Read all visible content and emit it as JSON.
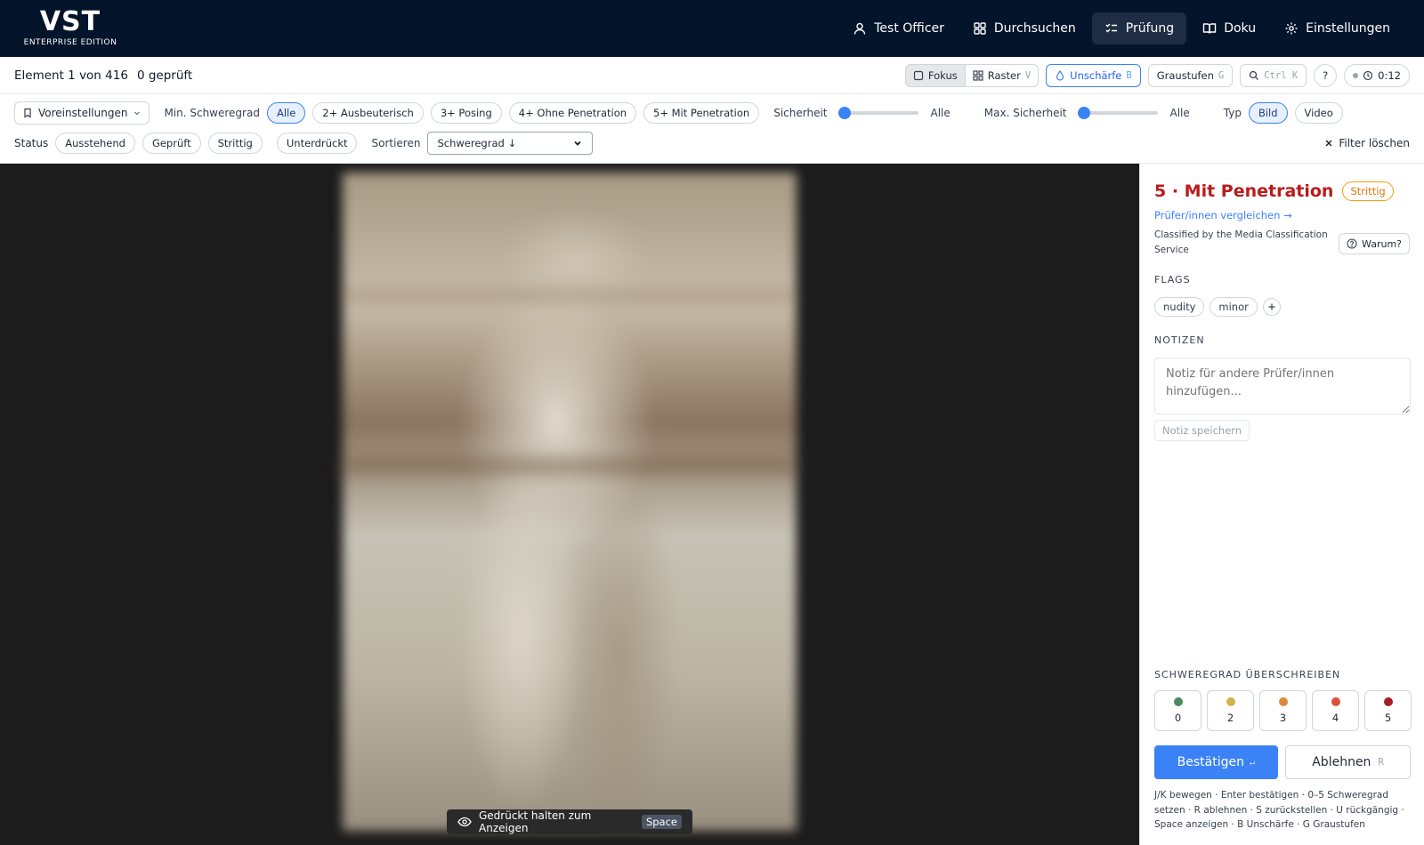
{
  "brand": {
    "name": "VST",
    "edition": "ENTERPRISE EDITION"
  },
  "nav": [
    {
      "label": "Test Officer",
      "icon": "user-icon"
    },
    {
      "label": "Durchsuchen",
      "icon": "grid-icon"
    },
    {
      "label": "Prüfung",
      "icon": "checklist-icon",
      "active": true
    },
    {
      "label": "Doku",
      "icon": "book-icon"
    },
    {
      "label": "Einstellungen",
      "icon": "gear-icon"
    }
  ],
  "status": {
    "position": "Element 1 von 416",
    "reviewed": "0 geprüft"
  },
  "toolbar": {
    "focus_label": "Fokus",
    "grid_label": "Raster",
    "grid_key": "V",
    "blur_label": "Unschärfe",
    "blur_key": "B",
    "grayscale_label": "Graustufen",
    "grayscale_key": "G",
    "search_key": "Ctrl K",
    "help_label": "?",
    "timer": "0:12"
  },
  "filters": {
    "presets_label": "Voreinstellungen",
    "min_severity_label": "Min. Schweregrad",
    "severity_chips": [
      "Alle",
      "2+ Ausbeuterisch",
      "3+ Posing",
      "4+ Ohne Penetration",
      "5+ Mit Penetration"
    ],
    "confidence_label": "Sicherheit",
    "confidence_value": "Alle",
    "max_confidence_label": "Max. Sicherheit",
    "max_confidence_value": "Alle",
    "type_label": "Typ",
    "type_chips": [
      "Bild",
      "Video"
    ],
    "status_label": "Status",
    "status_chips": [
      "Ausstehend",
      "Geprüft",
      "Strittig",
      "Unterdrückt"
    ],
    "sort_label": "Sortieren",
    "sort_value": "Schweregrad ↓",
    "clear_label": "Filter löschen"
  },
  "viewer": {
    "reveal_label": "Gedrückt halten zum Anzeigen",
    "reveal_key": "Space"
  },
  "panel": {
    "title": "5 · Mit Penetration",
    "badge": "Strittig",
    "compare_link": "Prüfer/innen vergleichen →",
    "classified_by": "Classified by the Media Classification Service",
    "why_label": "Warum?",
    "flags_heading": "FLAGS",
    "flags": [
      "nudity",
      "minor"
    ],
    "notes_heading": "NOTIZEN",
    "notes_placeholder": "Notiz für andere Prüfer/innen hinzufügen...",
    "save_note_label": "Notiz speichern",
    "override_heading": "SCHWEREGRAD ÜBERSCHREIBEN",
    "severity_levels": [
      {
        "label": "0",
        "color": "#4b8a5f"
      },
      {
        "label": "2",
        "color": "#d4b24a"
      },
      {
        "label": "3",
        "color": "#d98a3a"
      },
      {
        "label": "4",
        "color": "#d9533a"
      },
      {
        "label": "5",
        "color": "#a61e22"
      }
    ],
    "confirm_label": "Bestätigen",
    "confirm_key": "↵",
    "reject_label": "Ablehnen",
    "reject_key": "R",
    "shortcuts_text": "J/K bewegen · Enter bestätigen · 0–5 Schweregrad setzen · R ablehnen · S zurückstellen · U rückgängig · Space anzeigen · B Unschärfe · G Graustufen"
  }
}
